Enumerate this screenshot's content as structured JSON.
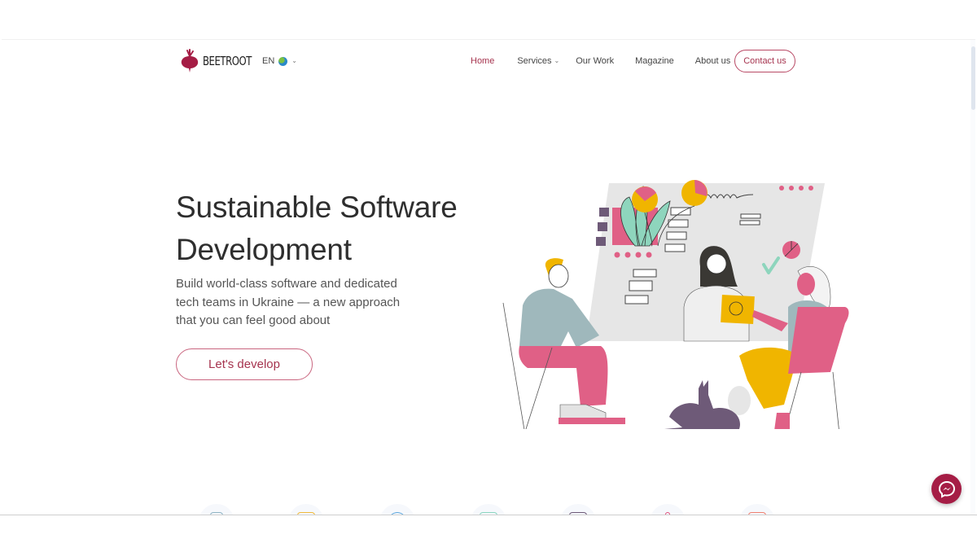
{
  "brand": {
    "name": "BEETROOT",
    "accent_color": "#a6344f",
    "messenger_color": "#a51d45"
  },
  "language": {
    "code": "EN",
    "icon": "globe-icon"
  },
  "nav": {
    "items": [
      {
        "label": "Home",
        "active": true,
        "has_dropdown": false
      },
      {
        "label": "Services",
        "active": false,
        "has_dropdown": true
      },
      {
        "label": "Our Work",
        "active": false,
        "has_dropdown": false
      },
      {
        "label": "Magazine",
        "active": false,
        "has_dropdown": false
      },
      {
        "label": "About us",
        "active": false,
        "has_dropdown": true
      }
    ],
    "contact_label": "Contact us"
  },
  "hero": {
    "title_line1": "Sustainable Software",
    "title_line2": "Development",
    "subtitle_line1": "Build world-class software and dedicated",
    "subtitle_line2": "tech teams in Ukraine — a new approach",
    "subtitle_line3": "that you can feel good about",
    "cta_label": "Let's develop",
    "illustration": "team-collaboration-illustration"
  },
  "service_icons": [
    {
      "icon": "mobile-icon",
      "color": "#8fb4c4"
    },
    {
      "icon": "browser-icon",
      "color": "#f0b93a"
    },
    {
      "icon": "globe-outline-icon",
      "color": "#5aa6dc"
    },
    {
      "icon": "window-icon",
      "color": "#8ad6c0"
    },
    {
      "icon": "terminal-icon",
      "color": "#6e5a78"
    },
    {
      "icon": "rocket-icon",
      "color": "#e04c7a"
    },
    {
      "icon": "layout-icon",
      "color": "#f08070"
    }
  ],
  "chat": {
    "icon": "messenger-icon"
  }
}
